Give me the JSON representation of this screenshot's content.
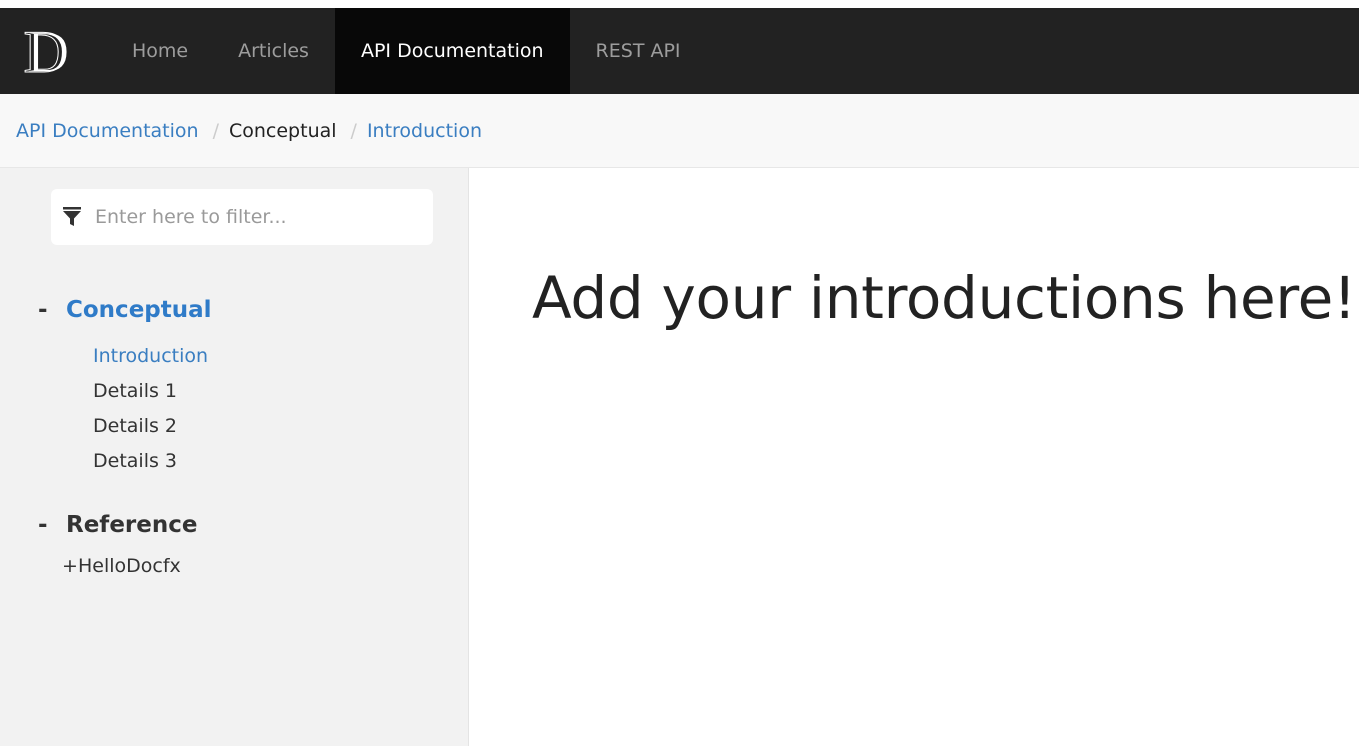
{
  "navbar": {
    "logo_letter": "D",
    "items": [
      {
        "label": "Home",
        "active": false
      },
      {
        "label": "Articles",
        "active": false
      },
      {
        "label": "API Documentation",
        "active": true
      },
      {
        "label": "REST API",
        "active": false
      }
    ]
  },
  "breadcrumb": {
    "items": [
      {
        "label": "API Documentation",
        "type": "link"
      },
      {
        "label": "Conceptual",
        "type": "current"
      },
      {
        "label": "Introduction",
        "type": "link"
      }
    ],
    "separator": "/"
  },
  "sidebar": {
    "filter": {
      "placeholder": "Enter here to filter...",
      "value": "",
      "icon": "filter-icon"
    },
    "toc": [
      {
        "toggle": "-",
        "title": "Conceptual",
        "active": true,
        "children": [
          {
            "label": "Introduction",
            "active": true
          },
          {
            "label": "Details 1",
            "active": false
          },
          {
            "label": "Details 2",
            "active": false
          },
          {
            "label": "Details 3",
            "active": false
          }
        ]
      },
      {
        "toggle": "-",
        "title": "Reference",
        "active": false,
        "sub_items": [
          {
            "toggle": "+",
            "label": "HelloDocfx"
          }
        ]
      }
    ]
  },
  "content": {
    "title": "Add your introductions here!"
  },
  "colors": {
    "navbar_bg": "#222222",
    "navbar_active_bg": "#080808",
    "link": "#3a7ec1",
    "sidebar_bg": "#f2f2f2"
  }
}
